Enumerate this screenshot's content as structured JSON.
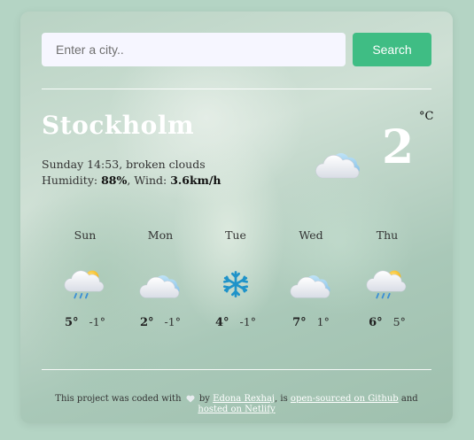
{
  "search": {
    "placeholder": "Enter a city..",
    "button_label": "Search"
  },
  "current": {
    "city": "Stockholm",
    "day_time": "Sunday 14:53",
    "description": "broken clouds",
    "humidity_label": "Humidity:",
    "humidity_value": "88%",
    "wind_label": "Wind:",
    "wind_value": "3.6km/h",
    "temperature": "2",
    "unit": "°C",
    "icon": "cloud-icon"
  },
  "forecast": [
    {
      "day": "Sun",
      "max": "5°",
      "min": "-1°",
      "icon": "rain-sun-icon"
    },
    {
      "day": "Mon",
      "max": "2°",
      "min": "-1°",
      "icon": "cloud-icon"
    },
    {
      "day": "Tue",
      "max": "4°",
      "min": "-1°",
      "icon": "snowflake-icon"
    },
    {
      "day": "Wed",
      "max": "7°",
      "min": "1°",
      "icon": "cloud-icon"
    },
    {
      "day": "Thu",
      "max": "6°",
      "min": "5°",
      "icon": "rain-sun-icon"
    }
  ],
  "footer": {
    "text_before": "This project was coded with",
    "by": "by",
    "author": "Edona Rexhaj",
    "is": ", is",
    "github_link": "open-sourced on Github",
    "and": "and",
    "netlify_link": "hosted on Netlify"
  },
  "colors": {
    "accent": "#3fbd84",
    "background": "#b4d4c4"
  }
}
